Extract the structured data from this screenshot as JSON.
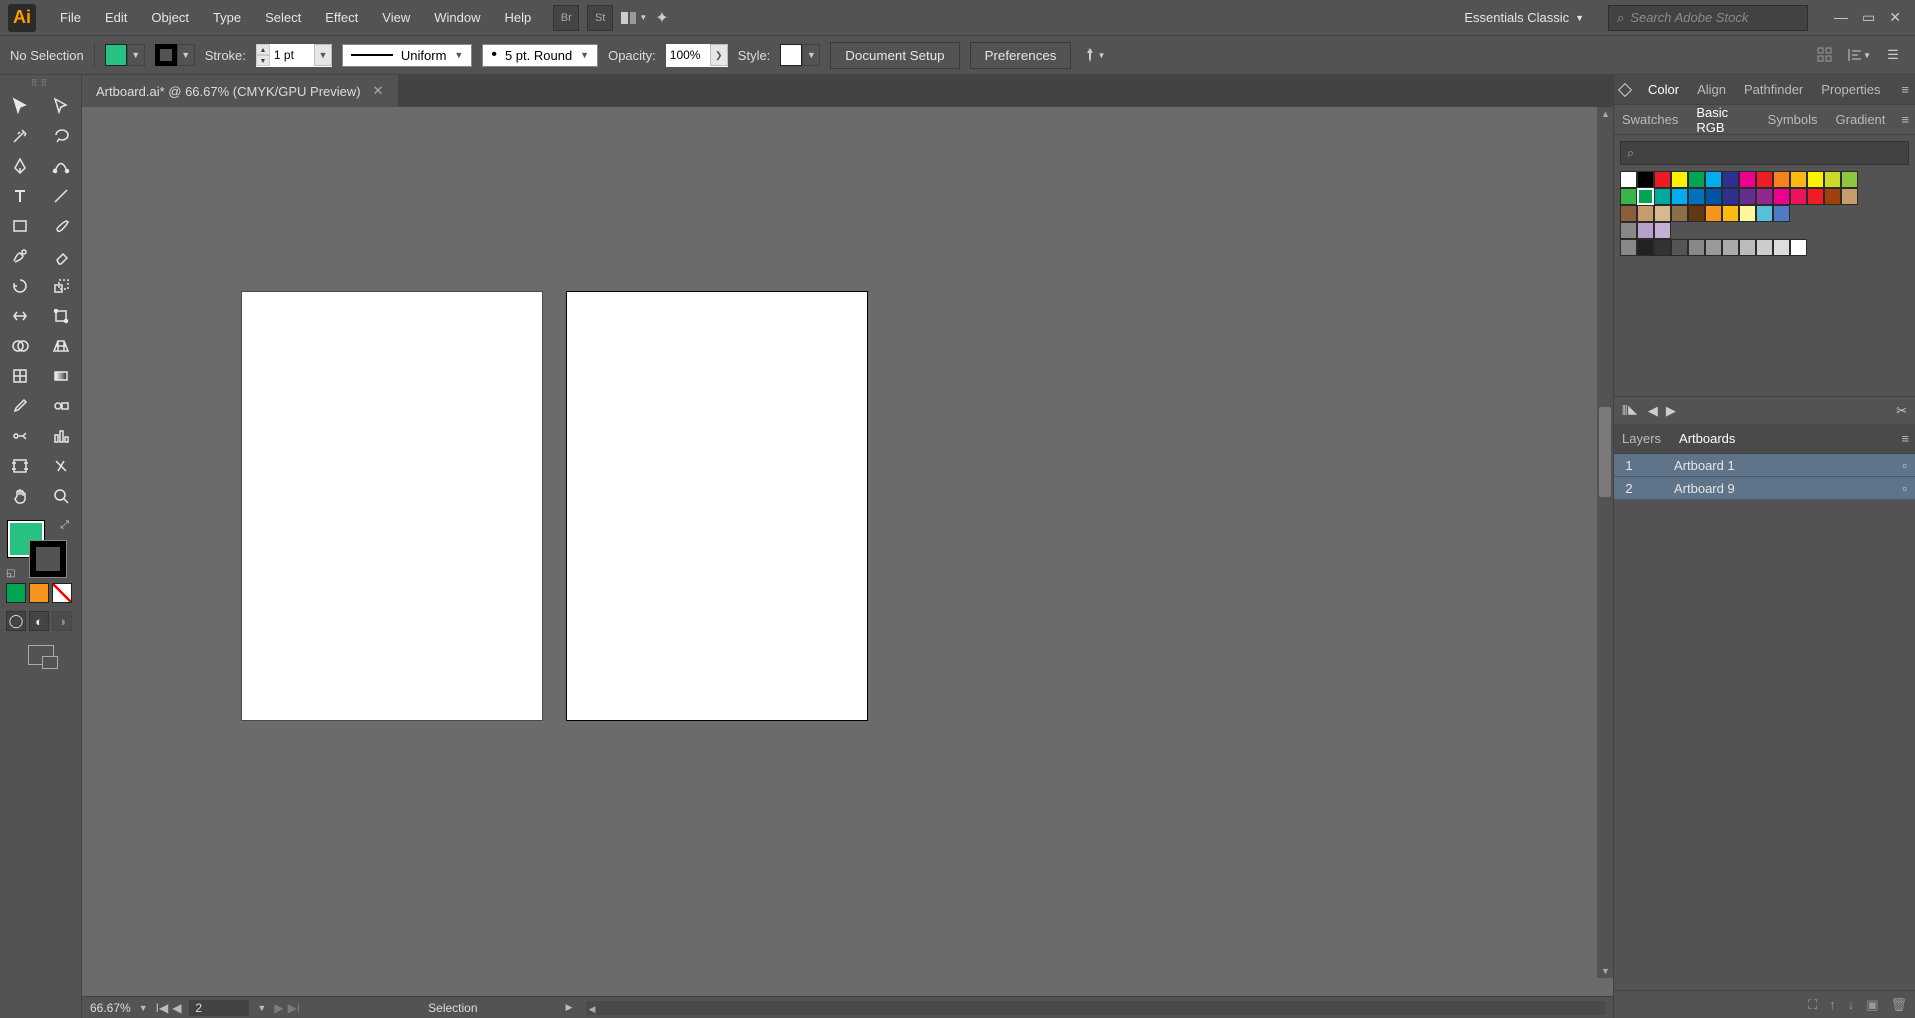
{
  "app": {
    "name": "Ai"
  },
  "menu": [
    "File",
    "Edit",
    "Object",
    "Type",
    "Select",
    "Effect",
    "View",
    "Window",
    "Help"
  ],
  "menubar_icons": [
    "Br",
    "St"
  ],
  "workspace": {
    "label": "Essentials Classic"
  },
  "search": {
    "placeholder": "Search Adobe Stock"
  },
  "controlbar": {
    "selection": "No Selection",
    "fill_color": "#27c181",
    "stroke_color": "#000000",
    "stroke_label": "Stroke:",
    "stroke_weight": "1 pt",
    "var_width": "Uniform",
    "brush": "5 pt. Round",
    "opacity_label": "Opacity:",
    "opacity": "100%",
    "style_label": "Style:",
    "doc_setup": "Document Setup",
    "prefs": "Preferences"
  },
  "document": {
    "tab": "Artboard.ai* @ 66.67% (CMYK/GPU Preview)"
  },
  "status": {
    "zoom": "66.67%",
    "artboard": "2",
    "tool": "Selection"
  },
  "right_tabs_top": [
    "Color",
    "Align",
    "Pathfinder",
    "Properties"
  ],
  "swatch_tabs": [
    "Swatches",
    "Basic RGB",
    "Symbols",
    "Gradient"
  ],
  "swatch_active": 1,
  "swatches_colors": [
    [
      "#ffffff",
      "#000000",
      "#ed1c24",
      "#fff200",
      "#00a651",
      "#00aeef",
      "#2e3192",
      "#ec008c",
      "#ee1d25",
      "#f5821f",
      "#fdb913",
      "#fff200",
      "#cadb2a",
      "#8dc63f"
    ],
    [
      "#39b54a",
      "#00a651",
      "#00a99d",
      "#00aeef",
      "#0072bc",
      "#0054a6",
      "#2e3192",
      "#662d91",
      "#92278f",
      "#ec008c",
      "#ed145b",
      "#ee1d25",
      "#a0410d",
      "#c69c6d"
    ],
    [
      "#8b5e3c",
      "#c69c6d",
      "#d7b98e",
      "#8b6f47",
      "#603913",
      "#f7941d",
      "#fdb913",
      "#fff799",
      "#55c1d9",
      "#4f7ac7"
    ],
    [
      "#888888",
      "#b9a0c9",
      "#c5b0d5"
    ],
    [
      "#222222",
      "#333333",
      "#555555",
      "#888888",
      "#999999",
      "#aaaaaa",
      "#bbbbbb",
      "#cccccc",
      "#dddddd",
      "#ffffff"
    ]
  ],
  "swatch_selected": {
    "row": 1,
    "col": 1
  },
  "layers_tabs": [
    "Layers",
    "Artboards"
  ],
  "layers_active": 1,
  "artboards": [
    {
      "index": "1",
      "name": "Artboard 1"
    },
    {
      "index": "2",
      "name": "Artboard 9"
    }
  ],
  "fill_stroke": {
    "fill": "#27c181",
    "stroke": "#000000",
    "row": [
      "#00a651",
      "#f7941d"
    ]
  }
}
